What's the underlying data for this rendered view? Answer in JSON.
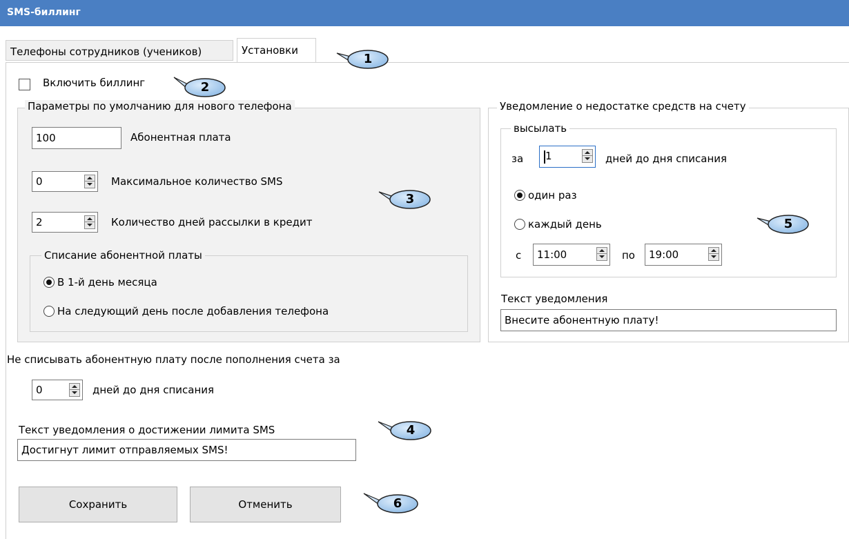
{
  "window": {
    "title": "SMS-биллинг"
  },
  "tabs": [
    {
      "label": "Телефоны сотрудников (учеников)"
    },
    {
      "label": "Установки"
    }
  ],
  "enable_billing": {
    "label": "Включить биллинг",
    "checked": false
  },
  "defaults": {
    "legend": "Параметры по умолчанию для нового телефона",
    "fee": {
      "value": "100",
      "label": "Абонентная плата"
    },
    "max_sms": {
      "value": "0",
      "label": "Максимальное количество SMS"
    },
    "credit_days": {
      "value": "2",
      "label": "Количество дней рассылки в кредит"
    },
    "charge": {
      "legend": "Списание абонентной платы",
      "options": [
        {
          "label": "В 1-й день месяца",
          "selected": true
        },
        {
          "label": "На следующий день после добавления телефона",
          "selected": false
        }
      ]
    }
  },
  "no_charge": {
    "label": "Не списывать абонентную плату после пополнения счета за",
    "value": "0",
    "suffix": "дней до дня списания"
  },
  "limit_text": {
    "label": "Текст уведомления о достижении лимита SMS",
    "value": "Достигнут лимит отправляемых SMS!"
  },
  "notify": {
    "legend": "Уведомление о недостатке средств на счету",
    "send": {
      "legend": "высылать",
      "prefix": "за",
      "days": "1",
      "suffix": "дней до дня списания",
      "options": [
        {
          "label": "один раз",
          "selected": true
        },
        {
          "label": "каждый день",
          "selected": false
        }
      ],
      "from_label": "с",
      "from": "11:00",
      "to_label": "по",
      "to": "19:00"
    },
    "text_label": "Текст уведомления",
    "text_value": "Внесите абонентную плату!"
  },
  "buttons": {
    "save": "Сохранить",
    "cancel": "Отменить"
  },
  "callouts": [
    "1",
    "2",
    "3",
    "4",
    "5",
    "6"
  ],
  "colors": {
    "title_bar": "#4a7fc3",
    "callout_fill": "#a9cdef",
    "panel": "#f2f2f2"
  }
}
